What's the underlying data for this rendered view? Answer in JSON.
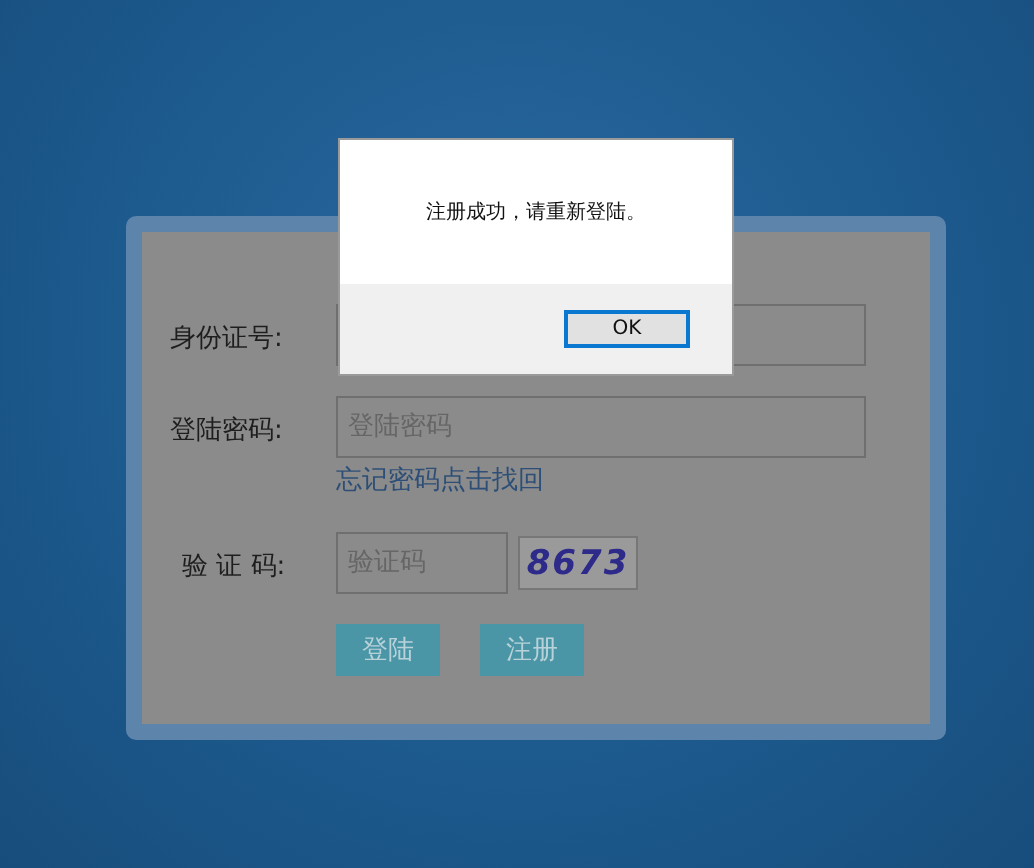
{
  "login_form": {
    "fields": [
      {
        "label": "身份证号:"
      },
      {
        "label": "登陆密码:",
        "placeholder": "登陆密码",
        "link": "忘记密码点击找回"
      },
      {
        "label": "验 证 码:",
        "placeholder": "验证码",
        "captcha": "8673"
      }
    ],
    "buttons": [
      "登陆",
      "注册"
    ]
  },
  "dialog": {
    "message": "注册成功，请重新登陆。",
    "button": "OK"
  }
}
